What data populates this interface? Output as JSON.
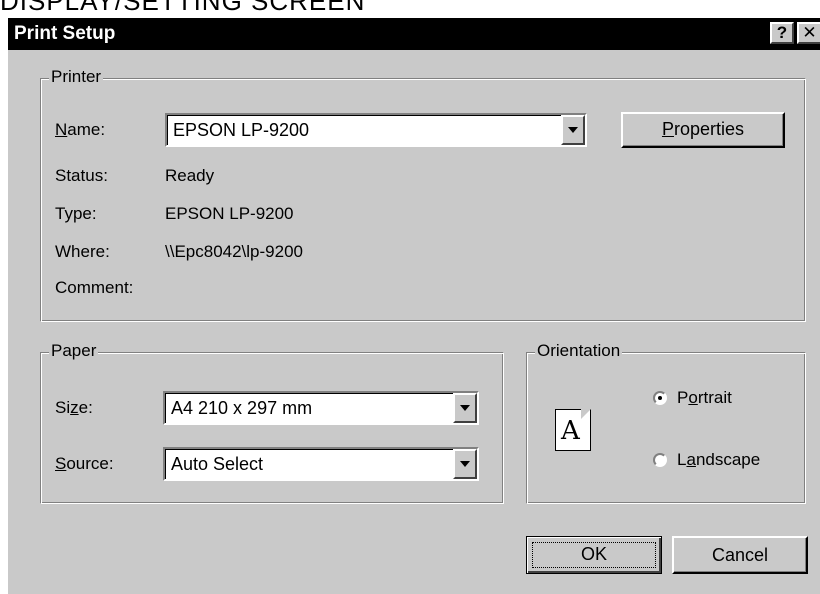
{
  "page_caption": "DISPLAY/SETTING SCREEN",
  "dialog": {
    "title": "Print Setup",
    "help_button": "?",
    "close_button": "✕"
  },
  "printer": {
    "group_label": "Printer",
    "name_label": "Name:",
    "name_value": "EPSON LP-9200",
    "properties_button": "Properties",
    "status_label": "Status:",
    "status_value": "Ready",
    "type_label": "Type:",
    "type_value": "EPSON LP-9200",
    "where_label": "Where:",
    "where_value": "\\\\Epc8042\\lp-9200",
    "comment_label": "Comment:",
    "comment_value": ""
  },
  "paper": {
    "group_label": "Paper",
    "size_label": "Size:",
    "size_value": "A4 210 x 297 mm",
    "source_label": "Source:",
    "source_value": "Auto Select"
  },
  "orientation": {
    "group_label": "Orientation",
    "icon_letter": "A",
    "portrait_label": "Portrait",
    "landscape_label": "Landscape",
    "selected": "Portrait"
  },
  "buttons": {
    "ok": "OK",
    "cancel": "Cancel"
  },
  "icons": {
    "combo_arrow": "chevron-down-icon",
    "orientation_page": "portrait-page-icon"
  }
}
